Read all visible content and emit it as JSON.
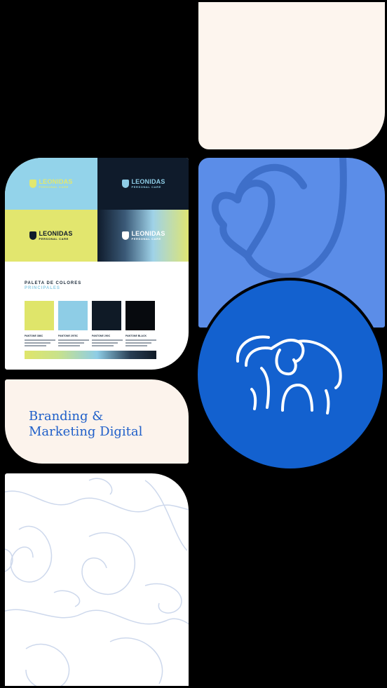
{
  "brand_board": {
    "logo_name": "LEONIDAS",
    "logo_subtitle": "PERSONAL CARE",
    "palette_title": "PALETA DE COLORES",
    "palette_subtitle": "PRINCIPALES",
    "swatches": [
      {
        "label": "PANTONE 386C",
        "color": "#dfe56a"
      },
      {
        "label": "PANTONE 2975C",
        "color": "#8ecde6"
      },
      {
        "label": "PANTONE 290C",
        "color": "#0f1a26"
      },
      {
        "label": "PANTONE BLACK",
        "color": "#070a0e"
      }
    ],
    "logo_cells": [
      {
        "background": "#93d3ea",
        "logo_color": "#e2e86e"
      },
      {
        "background": "#0f1b2b",
        "logo_color": "#8ecde6"
      },
      {
        "background": "#e2e66e",
        "logo_color": "#0f1b2b"
      },
      {
        "background": "gradient",
        "logo_color": "#ffffff"
      }
    ]
  },
  "tagline": {
    "line1": "Branding &",
    "line2": "Marketing Digital"
  },
  "icons": {
    "heart": "heart-outline-icon",
    "elephant": "elephant-outline-icon"
  },
  "colors": {
    "cream": "#fdf5ee",
    "blue_tile": "#5b8de8",
    "blue_circle": "#1361cf",
    "accent_text": "#1f5fc9"
  }
}
